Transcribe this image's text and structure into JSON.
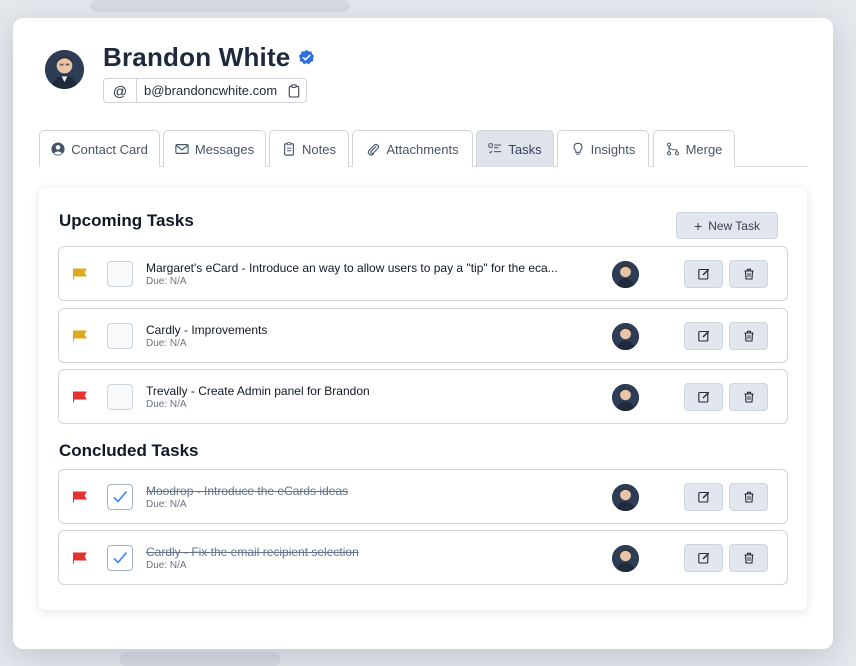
{
  "contact": {
    "name": "Brandon White",
    "email": "b@brandoncwhite.com",
    "at_symbol": "@"
  },
  "tabs": [
    {
      "label": "Contact Card",
      "icon": "user-circle-icon",
      "active": false
    },
    {
      "label": "Messages",
      "icon": "envelope-icon",
      "active": false
    },
    {
      "label": "Notes",
      "icon": "note-icon",
      "active": false
    },
    {
      "label": "Attachments",
      "icon": "paperclip-icon",
      "active": false
    },
    {
      "label": "Tasks",
      "icon": "task-list-icon",
      "active": true
    },
    {
      "label": "Insights",
      "icon": "lightbulb-icon",
      "active": false
    },
    {
      "label": "Merge",
      "icon": "merge-icon",
      "active": false
    }
  ],
  "upcoming": {
    "title": "Upcoming Tasks",
    "new_task_label": "New Task",
    "tasks": [
      {
        "title": "Margaret's eCard - Introduce an way to allow users to pay a \"tip\" for the eca...",
        "due": "Due: N/A",
        "flag_color": "#e0a81c",
        "done": false
      },
      {
        "title": "Cardly - Improvements",
        "due": "Due: N/A",
        "flag_color": "#e0a81c",
        "done": false
      },
      {
        "title": "Trevally - Create Admin panel for Brandon",
        "due": "Due: N/A",
        "flag_color": "#e5312f",
        "done": false
      }
    ]
  },
  "concluded": {
    "title": "Concluded Tasks",
    "tasks": [
      {
        "title": "Moodrop - Introduce the eCards ideas",
        "due": "Due: N/A",
        "flag_color": "#e5312f",
        "done": true
      },
      {
        "title": "Cardly - Fix the email recipient selection",
        "due": "Due: N/A",
        "flag_color": "#e5312f",
        "done": true
      }
    ]
  },
  "colors": {
    "accent": "#2f6fdc",
    "check": "#3b82f6"
  }
}
